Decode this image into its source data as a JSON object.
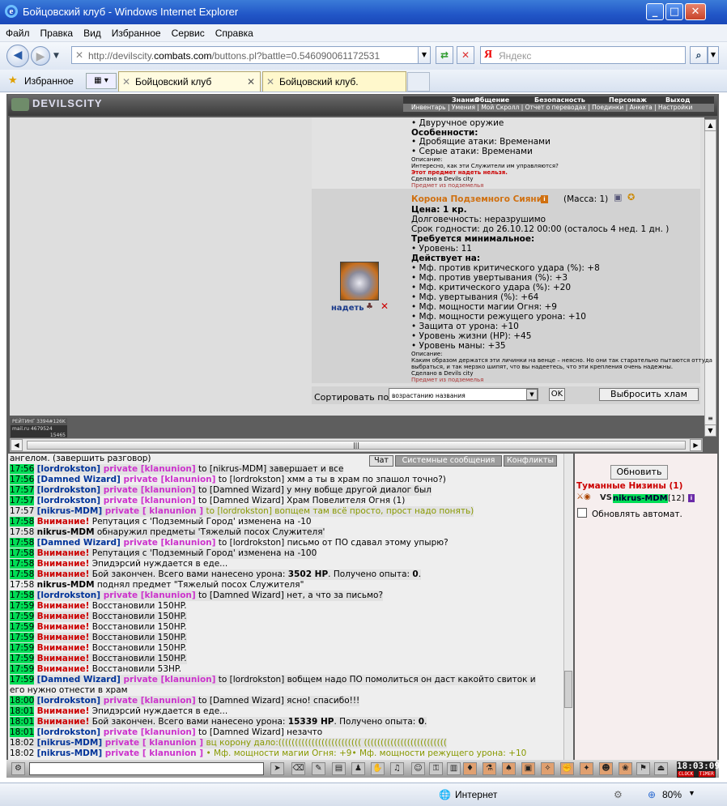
{
  "window": {
    "title": "Бойцовский клуб - Windows Internet Explorer"
  },
  "menu": [
    "Файл",
    "Правка",
    "Вид",
    "Избранное",
    "Сервис",
    "Справка"
  ],
  "address": {
    "prefix": "http://devilscity.",
    "host": "combats.com",
    "path": "/buttons.pl?battle=0.546090061172531"
  },
  "search": {
    "placeholder": "Яндекс"
  },
  "favorites_label": "Избранное",
  "tabs": [
    "Бойцовский клуб",
    "Бойцовский клуб."
  ],
  "site": {
    "logo": "DEVILSCITY",
    "top_links": [
      "Знания",
      "Общение",
      "Безопасность",
      "Персонаж",
      "Выход"
    ],
    "sub_links": "Инвентарь | Умения | Мой Скролл | Отчет о переводах | Поединки | Анкета | Настройки"
  },
  "item1": {
    "lines": [
      "• Двуручное оружие",
      "Особенности:",
      "• Дробящие атаки: Временами",
      "• Серые атаки: Временами"
    ],
    "desc_label": "Описание:",
    "desc": "Интересно, как эти Служители им управляются?",
    "cannot_wear": "Этот предмет надеть нельзя.",
    "made": "Сделано в Devils city",
    "from": "Предмет из подземелья"
  },
  "item2": {
    "name": "Корона Подземного Сияния",
    "mass": "(Масса: 1)",
    "price": "Цена: 1 кр.",
    "lines": [
      "Долговечность: неразрушимо",
      "Срок годности: до 26.10.12 00:00 (осталось 4 нед. 1 дн. )",
      "Требуется минимальное:",
      "• Уровень: 11",
      "Действует на:",
      "• Мф. против критического удара (%): +8",
      "• Мф. против увертывания (%): +3",
      "• Мф. критического удара (%): +20",
      "• Мф. увертывания (%): +64",
      "• Мф. мощности магии Огня: +9",
      "• Мф. мощности режущего урона: +10",
      "• Защита от урона: +10",
      "• Уровень жизни (HP): +45",
      "• Уровень маны: +35"
    ],
    "desc_label": "Описание:",
    "desc1": "Каким образом держатся эти личинки на венце – неясно. Но они так старательно пытаются оттуда",
    "desc2": "выбраться, и так мерзко шипят, что вы надеетесь, что эти крепления очень надежны.",
    "made": "Сделано в Devils city",
    "from": "Предмет из подземелья",
    "wear": "надеть"
  },
  "sort": {
    "label": "Сортировать по",
    "value": "возрастанию названия",
    "ok": "OK",
    "discard": "Выбросить хлам"
  },
  "counter": {
    "l1": "РЕЙТИНГ 3394#126K",
    "l2": "mail.ru 4679524",
    "l3": "15465"
  },
  "chat_tabs": [
    "Чат",
    "Системные сообщения",
    "Конфликты"
  ],
  "chat": [
    {
      "t": "",
      "hl": false,
      "parts": [
        [
          "ангелом. (завершить разговор)",
          ""
        ]
      ]
    },
    {
      "t": "17:56",
      "hl": true,
      "parts": [
        [
          "[lordrokston]",
          "nm"
        ],
        [
          " private [klanunion]",
          "pr"
        ],
        [
          " to [nikrus-MDM] завершает и все",
          ""
        ]
      ]
    },
    {
      "t": "17:56",
      "hl": true,
      "parts": [
        [
          "[Damned Wizard]",
          "nm"
        ],
        [
          " private [klanunion]",
          "pr"
        ],
        [
          " to [lordrokston] хмм а ты в храм по зпашол точно?)",
          ""
        ]
      ]
    },
    {
      "t": "17:57",
      "hl": true,
      "parts": [
        [
          "[lordrokston]",
          "nm"
        ],
        [
          " private [klanunion]",
          "pr"
        ],
        [
          " to [Damned Wizard] у мну вобще другой диалог был",
          ""
        ]
      ]
    },
    {
      "t": "17:57",
      "hl": true,
      "parts": [
        [
          "[lordrokston]",
          "nm"
        ],
        [
          " private [klanunion]",
          "pr"
        ],
        [
          " to [Damned Wizard] Храм Повелителя Огня (1)",
          ""
        ]
      ]
    },
    {
      "t": "17:57",
      "hl": false,
      "parts": [
        [
          "[nikrus-MDM]",
          "nm"
        ],
        [
          " private [ klanunion ]",
          "pr"
        ],
        [
          " to [lordrokston] вопщем там всё просто, прост надо понять)",
          "gr"
        ]
      ]
    },
    {
      "t": "17:58",
      "hl": true,
      "parts": [
        [
          "Внимание!",
          "wr"
        ],
        [
          " Репутация с 'Подземный Город' изменена на -10",
          ""
        ]
      ]
    },
    {
      "t": "17:58",
      "hl": false,
      "parts": [
        [
          "nikrus-MDM",
          "b"
        ],
        [
          " обнаружил предметы 'Тяжелый посох Служителя'",
          ""
        ]
      ]
    },
    {
      "t": "17:58",
      "hl": true,
      "parts": [
        [
          "[Damned Wizard]",
          "nm"
        ],
        [
          " private [klanunion]",
          "pr"
        ],
        [
          " to [lordrokston] письмо от ПО сдавал этому упырю?",
          ""
        ]
      ]
    },
    {
      "t": "17:58",
      "hl": true,
      "parts": [
        [
          "Внимание!",
          "wr"
        ],
        [
          " Репутация с 'Подземный Город' изменена на -100",
          ""
        ]
      ]
    },
    {
      "t": "17:58",
      "hl": true,
      "parts": [
        [
          "Внимание!",
          "wr"
        ],
        [
          " Эпидэрсий нуждается в еде...",
          ""
        ]
      ]
    },
    {
      "t": "17:58",
      "hl": true,
      "parts": [
        [
          "Внимание!",
          "wr"
        ],
        [
          " Бой закончен. Всего вами нанесено урона: ",
          ""
        ],
        [
          "3502 HP",
          "b"
        ],
        [
          ". Получено опыта: ",
          ""
        ],
        [
          "0",
          "b"
        ],
        [
          ".",
          ""
        ]
      ]
    },
    {
      "t": "17:58",
      "hl": false,
      "parts": [
        [
          "nikrus-MDM",
          "b"
        ],
        [
          " поднял предмет \"Тяжелый посох Служителя\"",
          ""
        ]
      ]
    },
    {
      "t": "17:58",
      "hl": true,
      "parts": [
        [
          "[lordrokston]",
          "nm"
        ],
        [
          " private [klanunion]",
          "pr"
        ],
        [
          " to [Damned Wizard] нет, а что за письмо?",
          ""
        ]
      ]
    },
    {
      "t": "17:59",
      "hl": true,
      "parts": [
        [
          "Внимание!",
          "wr"
        ],
        [
          " Восстановили 150HP.",
          ""
        ]
      ]
    },
    {
      "t": "17:59",
      "hl": true,
      "parts": [
        [
          "Внимание!",
          "wr"
        ],
        [
          " Восстановили 150HP.",
          ""
        ]
      ]
    },
    {
      "t": "17:59",
      "hl": true,
      "parts": [
        [
          "Внимание!",
          "wr"
        ],
        [
          " Восстановили 150HP.",
          ""
        ]
      ]
    },
    {
      "t": "17:59",
      "hl": true,
      "parts": [
        [
          "Внимание!",
          "wr"
        ],
        [
          " Восстановили 150HP.",
          ""
        ]
      ]
    },
    {
      "t": "17:59",
      "hl": true,
      "parts": [
        [
          "Внимание!",
          "wr"
        ],
        [
          " Восстановили 150HP.",
          ""
        ]
      ]
    },
    {
      "t": "17:59",
      "hl": true,
      "parts": [
        [
          "Внимание!",
          "wr"
        ],
        [
          " Восстановили 150HP.",
          ""
        ]
      ]
    },
    {
      "t": "17:59",
      "hl": true,
      "parts": [
        [
          "Внимание!",
          "wr"
        ],
        [
          " Восстановили 53HP.",
          ""
        ]
      ]
    },
    {
      "t": "17:59",
      "hl": true,
      "parts": [
        [
          "[Damned Wizard]",
          "nm"
        ],
        [
          " private [klanunion]",
          "pr"
        ],
        [
          " to [lordrokston] вобщем надо ПО помолиться он даст какойто свиток и",
          ""
        ]
      ]
    },
    {
      "t": "",
      "hl": false,
      "parts": [
        [
          "его нужно отнести в храм",
          ""
        ]
      ]
    },
    {
      "t": "18:00",
      "hl": true,
      "parts": [
        [
          "[lordrokston]",
          "nm"
        ],
        [
          " private [klanunion]",
          "pr"
        ],
        [
          " to [Damned Wizard] ясно! спасибо!!!",
          ""
        ]
      ]
    },
    {
      "t": "18:01",
      "hl": true,
      "parts": [
        [
          "Внимание!",
          "wr"
        ],
        [
          " Эпидэрсий нуждается в еде...",
          ""
        ]
      ]
    },
    {
      "t": "18:01",
      "hl": true,
      "parts": [
        [
          "Внимание!",
          "wr"
        ],
        [
          " Бой закончен. Всего вами нанесено урона: ",
          ""
        ],
        [
          "15339 HP",
          "b"
        ],
        [
          ". Получено опыта: ",
          ""
        ],
        [
          "0",
          "b"
        ],
        [
          ".",
          ""
        ]
      ]
    },
    {
      "t": "18:01",
      "hl": true,
      "parts": [
        [
          "[lordrokston]",
          "nm"
        ],
        [
          " private [klanunion]",
          "pr"
        ],
        [
          " to [Damned Wizard] незачто",
          ""
        ]
      ]
    },
    {
      "t": "18:02",
      "hl": false,
      "parts": [
        [
          "[nikrus-MDM]",
          "nm"
        ],
        [
          " private [ klanunion ]",
          "pr"
        ],
        [
          " вц корону дало:((((((((((((((((((((((((( (((((((((((((((((((((((((",
          "gr"
        ]
      ]
    },
    {
      "t": "18:02",
      "hl": false,
      "parts": [
        [
          "[nikrus-MDM]",
          "nm"
        ],
        [
          " private [ klanunion ]",
          "pr"
        ],
        [
          " • Мф. мощности магии Огня: +9• Мф. мощности режущего урона: +10",
          "gr"
        ]
      ]
    }
  ],
  "right": {
    "refresh": "Обновить",
    "location": "Туманные Низины (1)",
    "player": "nikrus-MDM",
    "level": "[12]",
    "vs": "VS",
    "auto": "Обновлять автомат."
  },
  "clock": {
    "time": "18:03:09",
    "a": "CLOCK",
    "b": "TIMER"
  },
  "status": {
    "zone": "Интернет",
    "zoom": "80%"
  }
}
